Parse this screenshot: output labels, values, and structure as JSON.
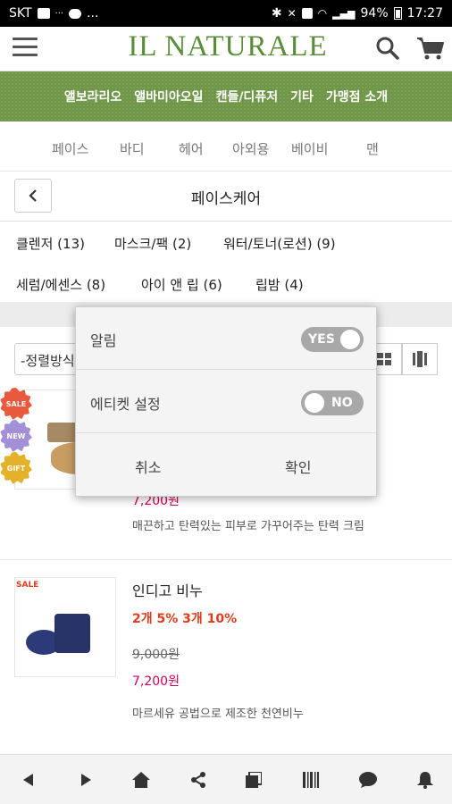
{
  "status_bar": {
    "carrier": "SKT",
    "dots": "···",
    "more": "...",
    "battery": "94%",
    "time": "17:27"
  },
  "header": {
    "brand": "IL NATURALE",
    "menu_icon": "hamburger-menu-icon",
    "search_icon": "search-icon",
    "cart_icon": "cart-icon"
  },
  "main_nav": [
    "앨보라리오",
    "앨바미아오일",
    "캔들/디퓨저",
    "기타",
    "가맹점 소개"
  ],
  "category_tabs": [
    "페이스",
    "바디",
    "헤어",
    "아외용",
    "베이비",
    "맨"
  ],
  "page": {
    "title": "페이스케어",
    "back_icon": "chevron-left-icon"
  },
  "subcategories": [
    "클렌저 (13)",
    "마스크/팩 (2)",
    "워터/토너(로션) (9)",
    "세럼/에센스 (8)",
    "아이 앤 립 (6)",
    "립밤 (4)"
  ],
  "sort": {
    "label": "-정렬방식"
  },
  "products": [
    {
      "badges": [
        "SALE",
        "NEW",
        "GIFT"
      ],
      "price_partial": "7,200원",
      "desc": "매끈하고 탄력있는 피부로 가꾸어주는 탄력 크림"
    },
    {
      "badge": "SALE",
      "name": "인디고 비누",
      "promo": "2개 5% 3개 10%",
      "old_price": "9,000원",
      "price": "7,200원",
      "desc": "마르세유 공법으로 제조한 천연비누"
    }
  ],
  "dialog": {
    "rows": [
      {
        "label": "알림",
        "toggle": "YES"
      },
      {
        "label": "에티켓 설정",
        "toggle": "NO"
      }
    ],
    "cancel": "취소",
    "confirm": "확인"
  },
  "bottom_bar": [
    "back-icon",
    "forward-icon",
    "home-icon",
    "share-icon",
    "tabs-icon",
    "barcode-icon",
    "chat-icon",
    "bell-icon"
  ],
  "colors": {
    "brand_green": "#5a8d3a",
    "nav_green": "#6f9647",
    "price_pink": "#d1005d",
    "promo_red": "#e03b1c"
  }
}
